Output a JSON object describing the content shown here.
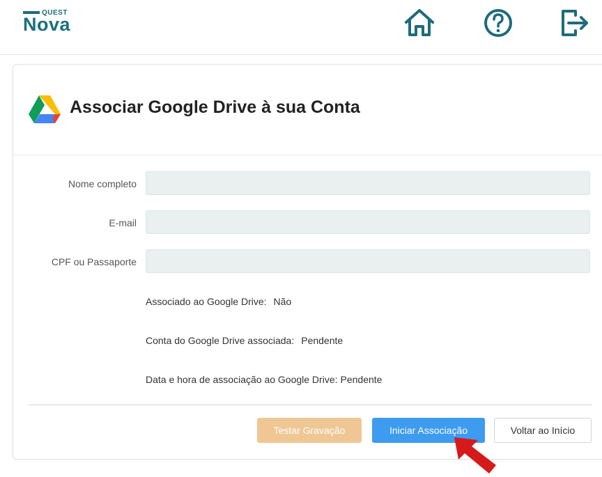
{
  "header": {
    "logo": {
      "small": "QUEST",
      "large": "Nova"
    },
    "icons": [
      "home-icon",
      "help-icon",
      "exit-icon"
    ]
  },
  "card": {
    "title": "Associar Google Drive à sua Conta",
    "form": {
      "full_name_label": "Nome completo",
      "full_name_value": "",
      "email_label": "E-mail",
      "email_value": "",
      "document_label": "CPF ou Passaporte",
      "document_value": ""
    },
    "status": {
      "associated_label": "Associado ao Google Drive:",
      "associated_value": "Não",
      "account_label": "Conta do Google Drive associada:",
      "account_value": "Pendente",
      "datetime_label": "Data e hora de associação ao Google Drive:",
      "datetime_value": "Pendente"
    },
    "buttons": {
      "test": "Testar Gravação",
      "start": "Iniciar Associação",
      "back": "Voltar ao Início"
    }
  },
  "colors": {
    "brand": "#1a6f80",
    "test_button": "#efc794",
    "start_button": "#3d9bf0",
    "arrow": "#d61a1a"
  }
}
